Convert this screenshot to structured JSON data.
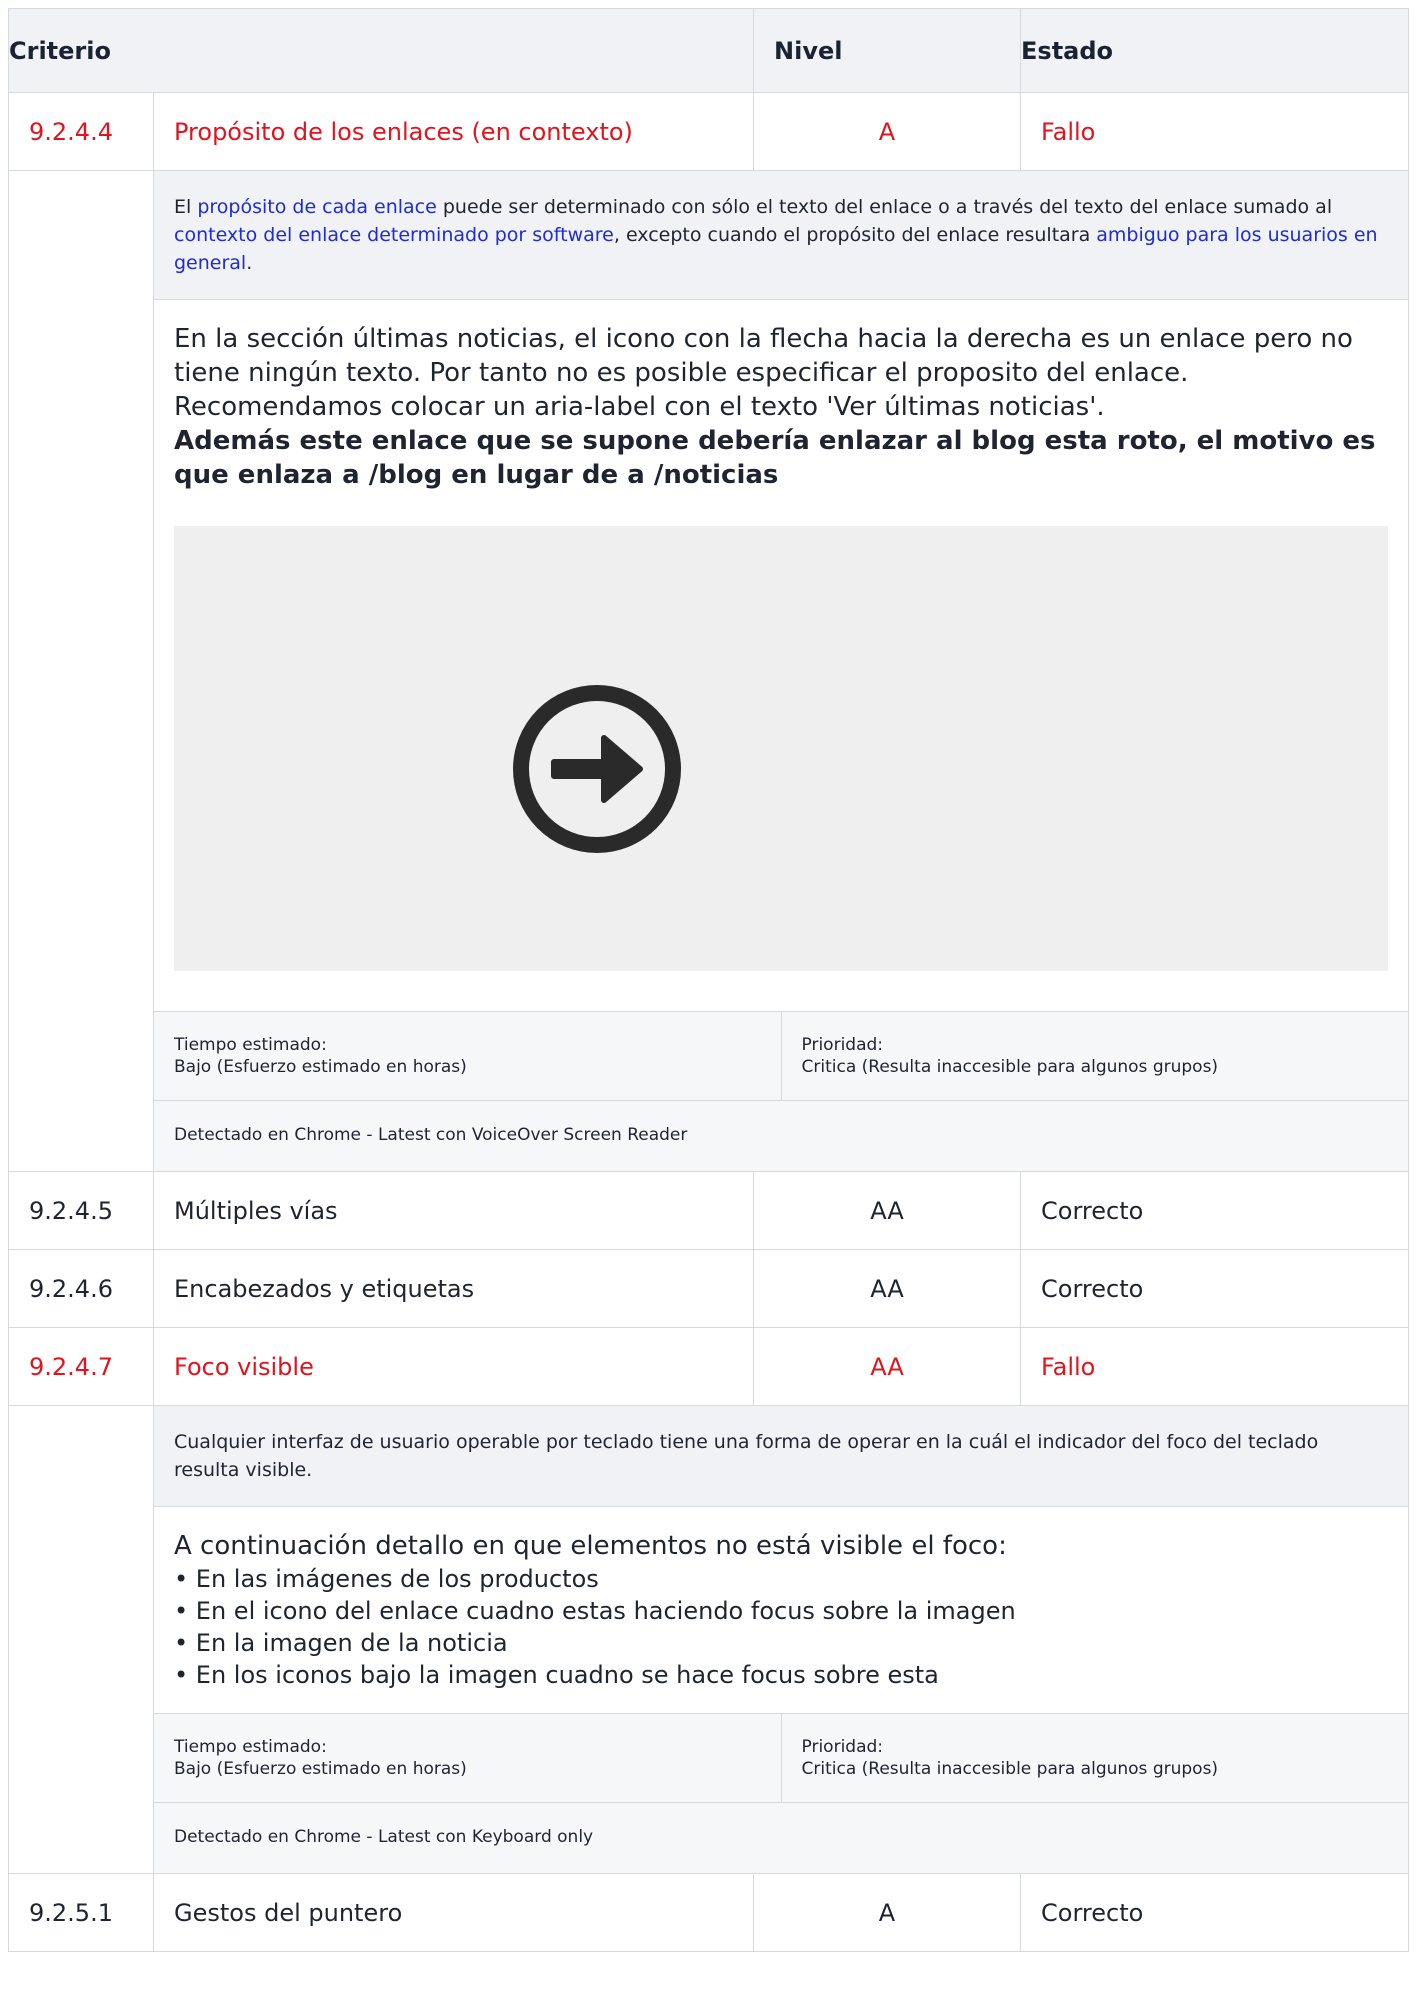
{
  "header": {
    "criterio": "Criterio",
    "nivel": "Nivel",
    "estado": "Estado"
  },
  "rows": [
    {
      "num": "9.2.4.4",
      "name": "Propósito de los enlaces (en contexto)",
      "level": "A",
      "status": "Fallo",
      "desc": {
        "t1": "El ",
        "l1": "propósito de cada enlace",
        "t2": " puede ser determinado con sólo el texto del enlace o a través del texto del enlace sumado al ",
        "l2": "contexto del enlace determinado por software",
        "t3": ", excepto cuando el propósito del enlace resultara ",
        "l3": "ambiguo para los usuarios en general",
        "t4": "."
      },
      "note": "En la sección últimas noticias, el icono con la flecha hacia la derecha es un enlace pero no tiene ningún texto. Por tanto no es posible especificar el proposito del enlace. Recomendamos colocar un aria-label con el texto 'Ver últimas noticias'.",
      "note_bold": "Además este enlace que se supone debería enlazar al blog esta roto, el motivo es que enlaza a /blog en lugar de a /noticias",
      "screenshot_icon": "arrow-circle-right-icon",
      "time_label": "Tiempo estimado:",
      "time_value": "Bajo (Esfuerzo estimado en horas)",
      "priority_label": "Prioridad:",
      "priority_value": "Critica (Resulta inaccesible para algunos grupos)",
      "detected": "Detectado en Chrome - Latest con VoiceOver Screen Reader"
    },
    {
      "num": "9.2.4.5",
      "name": "Múltiples vías",
      "level": "AA",
      "status": "Correcto"
    },
    {
      "num": "9.2.4.6",
      "name": "Encabezados y etiquetas",
      "level": "AA",
      "status": "Correcto"
    },
    {
      "num": "9.2.4.7",
      "name": "Foco visible",
      "level": "AA",
      "status": "Fallo",
      "desc": "Cualquier interfaz de usuario operable por teclado tiene una forma de operar en la cuál el indicador del foco del teclado resulta visible.",
      "note_intro": "A continuación detallo en que elementos no está visible el foco:",
      "bullets": [
        "En las imágenes de los productos",
        "En el icono del enlace cuadno estas haciendo focus sobre la imagen",
        "En la imagen de la noticia",
        "En los iconos bajo la imagen cuadno se hace focus sobre esta"
      ],
      "time_label": "Tiempo estimado:",
      "time_value": "Bajo (Esfuerzo estimado en horas)",
      "priority_label": "Prioridad:",
      "priority_value": "Critica (Resulta inaccesible para algunos grupos)",
      "detected": "Detectado en Chrome - Latest con Keyboard only"
    },
    {
      "num": "9.2.5.1",
      "name": "Gestos del puntero",
      "level": "A",
      "status": "Correcto"
    }
  ],
  "colors": {
    "fail": "#e0141e",
    "link": "#1e2bd6",
    "header_bg": "#f0f2f5"
  }
}
